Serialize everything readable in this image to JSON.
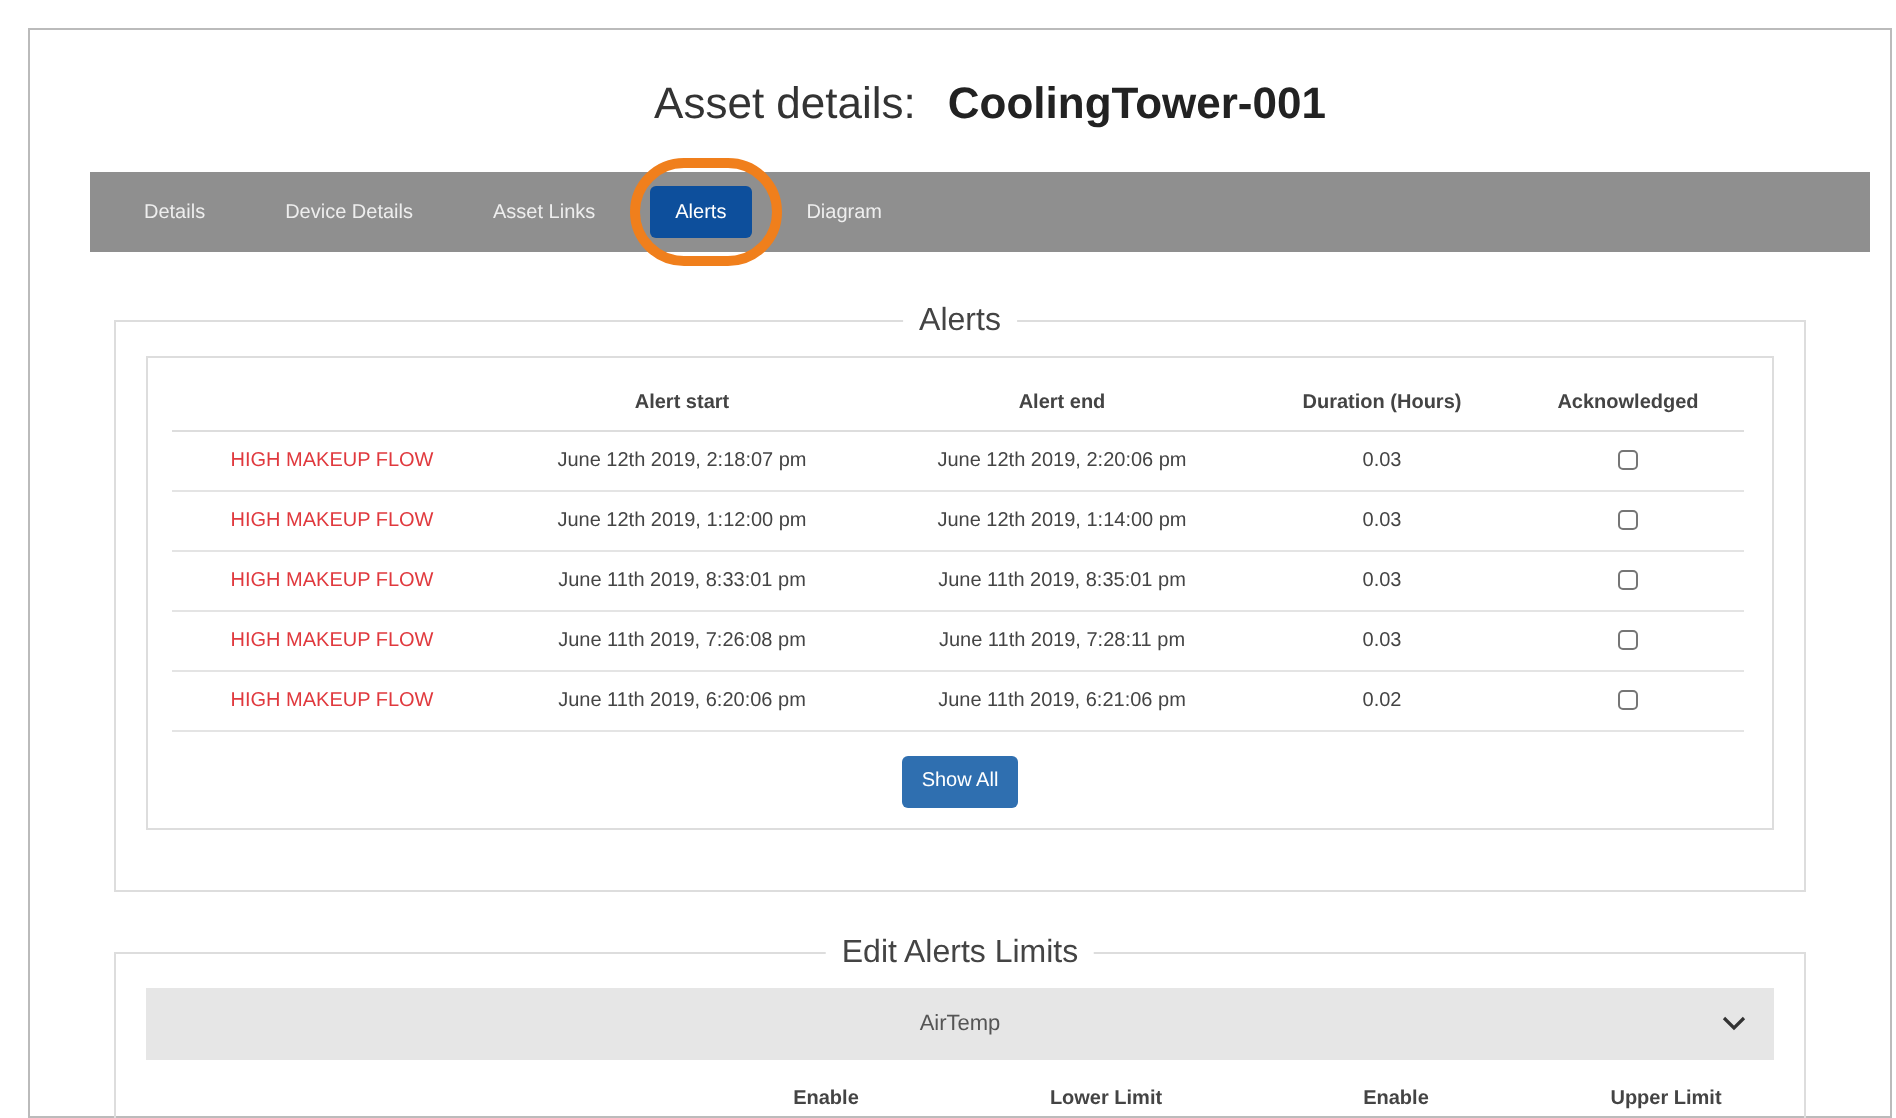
{
  "page_title": {
    "label": "Asset details:",
    "asset": "CoolingTower-001"
  },
  "tabs": [
    {
      "label": "Details",
      "selected": false,
      "circled": false
    },
    {
      "label": "Device Details",
      "selected": false,
      "circled": false
    },
    {
      "label": "Asset Links",
      "selected": false,
      "circled": false
    },
    {
      "label": "Alerts",
      "selected": true,
      "circled": true
    },
    {
      "label": "Diagram",
      "selected": false,
      "circled": false
    }
  ],
  "alerts": {
    "title": "Alerts",
    "columns": [
      "Alert start",
      "Alert end",
      "Duration (Hours)",
      "Acknowledged"
    ],
    "rows": [
      {
        "name": "HIGH MAKEUP FLOW",
        "start": "June 12th 2019, 2:18:07 pm",
        "end": "June 12th 2019, 2:20:06 pm",
        "duration": "0.03",
        "acknowledged": false
      },
      {
        "name": "HIGH MAKEUP FLOW",
        "start": "June 12th 2019, 1:12:00 pm",
        "end": "June 12th 2019, 1:14:00 pm",
        "duration": "0.03",
        "acknowledged": false
      },
      {
        "name": "HIGH MAKEUP FLOW",
        "start": "June 11th 2019, 8:33:01 pm",
        "end": "June 11th 2019, 8:35:01 pm",
        "duration": "0.03",
        "acknowledged": false
      },
      {
        "name": "HIGH MAKEUP FLOW",
        "start": "June 11th 2019, 7:26:08 pm",
        "end": "June 11th 2019, 7:28:11 pm",
        "duration": "0.03",
        "acknowledged": false
      },
      {
        "name": "HIGH MAKEUP FLOW",
        "start": "June 11th 2019, 6:20:06 pm",
        "end": "June 11th 2019, 6:21:06 pm",
        "duration": "0.02",
        "acknowledged": false
      }
    ],
    "button": "Show All"
  },
  "limits": {
    "title": "Edit Alerts Limits",
    "group": {
      "label": "AirTemp",
      "expanded": true
    },
    "columns": [
      "Enable",
      "Lower Limit",
      "Enable",
      "Upper Limit"
    ]
  }
}
